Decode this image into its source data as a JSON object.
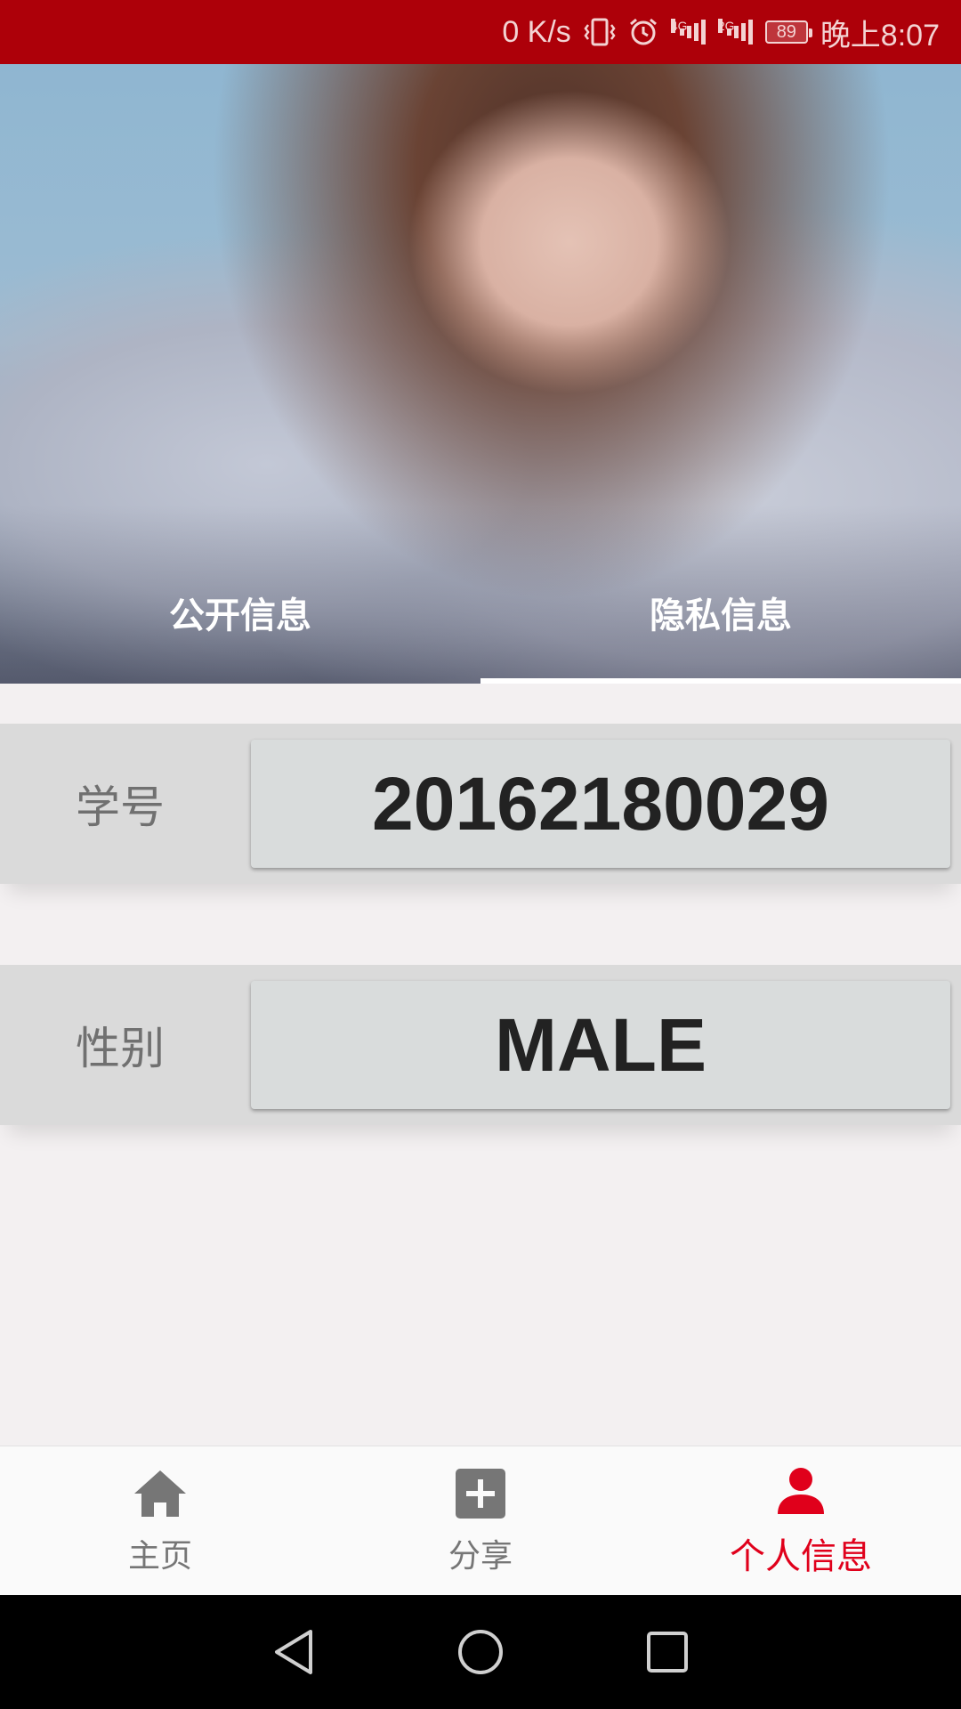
{
  "status_bar": {
    "speed": "0 K/s",
    "net1": "4G",
    "net2": "2G",
    "battery": "89",
    "time": "晚上8:07"
  },
  "tabs": [
    {
      "label": "公开信息",
      "active": false
    },
    {
      "label": "隐私信息",
      "active": true
    }
  ],
  "info": {
    "student_id": {
      "label": "学号",
      "value": "20162180029"
    },
    "gender": {
      "label": "性别",
      "value": "MALE"
    }
  },
  "bottom_nav": [
    {
      "label": "主页",
      "icon": "home-icon",
      "active": false
    },
    {
      "label": "分享",
      "icon": "add-box-icon",
      "active": false
    },
    {
      "label": "个人信息",
      "icon": "person-icon",
      "active": true
    }
  ],
  "colors": {
    "status_bar": "#ad0009",
    "accent": "#e0001b",
    "inactive": "#767676"
  }
}
